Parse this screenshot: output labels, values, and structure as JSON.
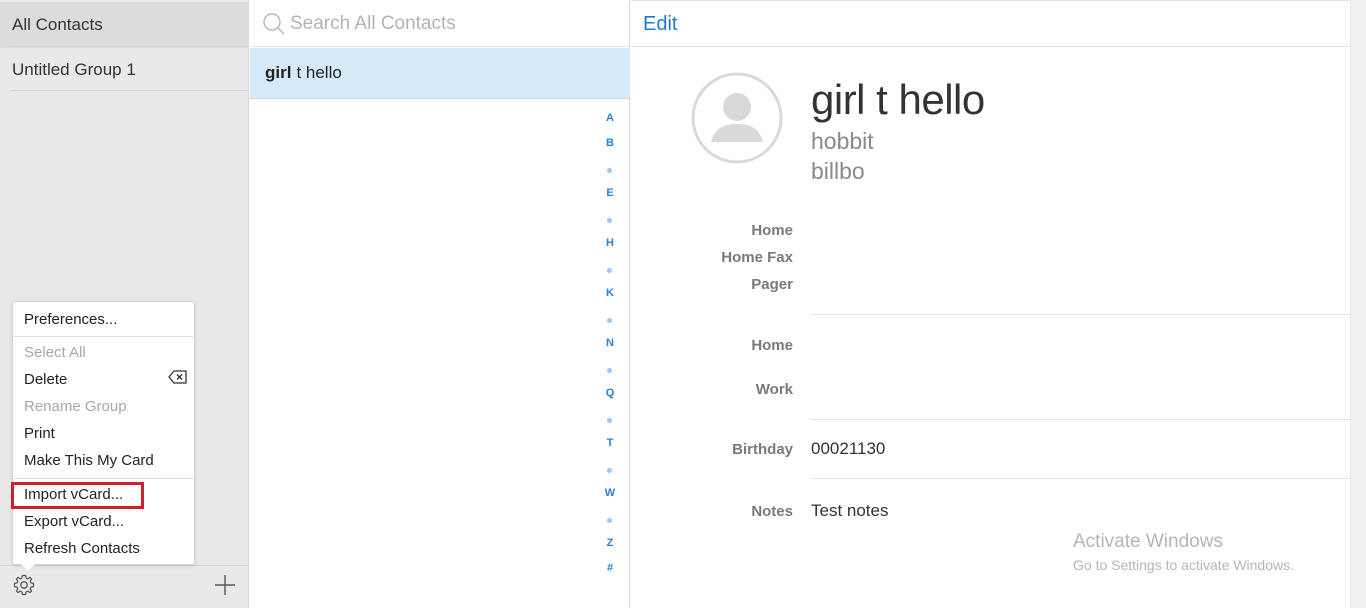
{
  "groups": {
    "items": [
      {
        "label": "All Contacts"
      },
      {
        "label": "Untitled Group 1"
      }
    ]
  },
  "menu": {
    "items": [
      {
        "label": "Preferences...",
        "enabled": true
      },
      {
        "label": "Select All",
        "enabled": false
      },
      {
        "label": "Delete",
        "enabled": true
      },
      {
        "label": "Rename Group",
        "enabled": false
      },
      {
        "label": "Print",
        "enabled": true
      },
      {
        "label": "Make This My Card",
        "enabled": true
      },
      {
        "label": "Import vCard...",
        "enabled": true
      },
      {
        "label": "Export vCard...",
        "enabled": true
      },
      {
        "label": "Refresh Contacts",
        "enabled": true
      }
    ],
    "highlight_color": "#d2202a"
  },
  "search": {
    "placeholder": "Search All Contacts"
  },
  "contacts": [
    {
      "first": "girl",
      "rest": "t hello"
    }
  ],
  "index_letters": [
    "A",
    "B",
    "•",
    "E",
    "•",
    "H",
    "•",
    "K",
    "•",
    "N",
    "•",
    "Q",
    "•",
    "T",
    "•",
    "W",
    "•",
    "Z",
    "#"
  ],
  "detail": {
    "edit_label": "Edit",
    "name": "girl t hello",
    "sub1": "hobbit",
    "sub2": "billbo",
    "phone_labels": [
      "Home",
      "Home Fax",
      "Pager"
    ],
    "address_labels": [
      "Home",
      "Work"
    ],
    "birthday_label": "Birthday",
    "birthday_value": "00021130",
    "notes_label": "Notes",
    "notes_value": "Test notes"
  },
  "watermark": {
    "line1": "Activate Windows",
    "line2": "Go to Settings to activate Windows."
  },
  "colors": {
    "accent": "#1d7bd0",
    "selected_row": "#d6e9f9",
    "sidebar_bg": "#e9e9ea"
  }
}
